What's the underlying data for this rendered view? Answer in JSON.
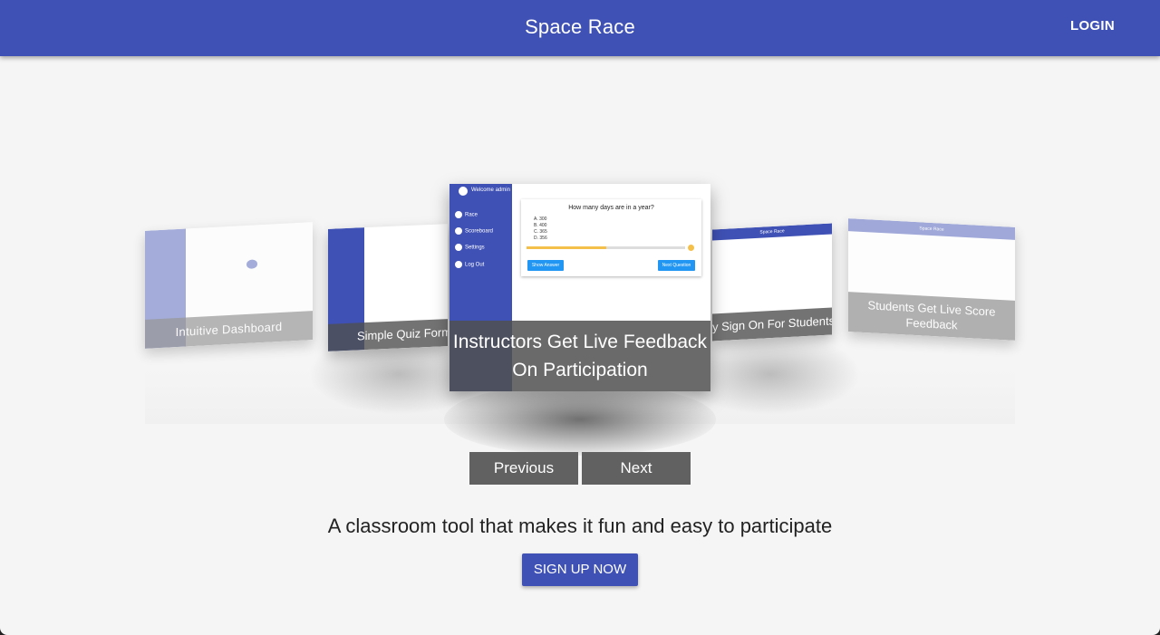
{
  "header": {
    "title": "Space Race",
    "login_label": "LOGIN",
    "color": "#3f51b5"
  },
  "carousel": {
    "slides": [
      {
        "caption": "Intuitive Dashboard"
      },
      {
        "caption": "Simple Quiz Forms"
      },
      {
        "caption": "Instructors Get Live Feedback On Participation",
        "preview": {
          "welcome": "Welcome admin",
          "nav": [
            "Race",
            "Scoreboard",
            "Settings",
            "Log Out"
          ],
          "question": "How many days are in a year?",
          "options": [
            "A. 300",
            "B. 400",
            "C. 365",
            "D. 356"
          ],
          "show_answer": "Show Answer",
          "next_question": "Next Question",
          "progress": 0.5
        }
      },
      {
        "caption": "y Sign On For Students",
        "topbar": "Space Race"
      },
      {
        "caption": "Students Get Live Score Feedback",
        "topbar": "Space Race"
      }
    ],
    "previous_label": "Previous",
    "next_label": "Next"
  },
  "main": {
    "tagline": "A classroom tool that makes it fun and easy to participate",
    "signup_label": "SIGN UP NOW"
  }
}
